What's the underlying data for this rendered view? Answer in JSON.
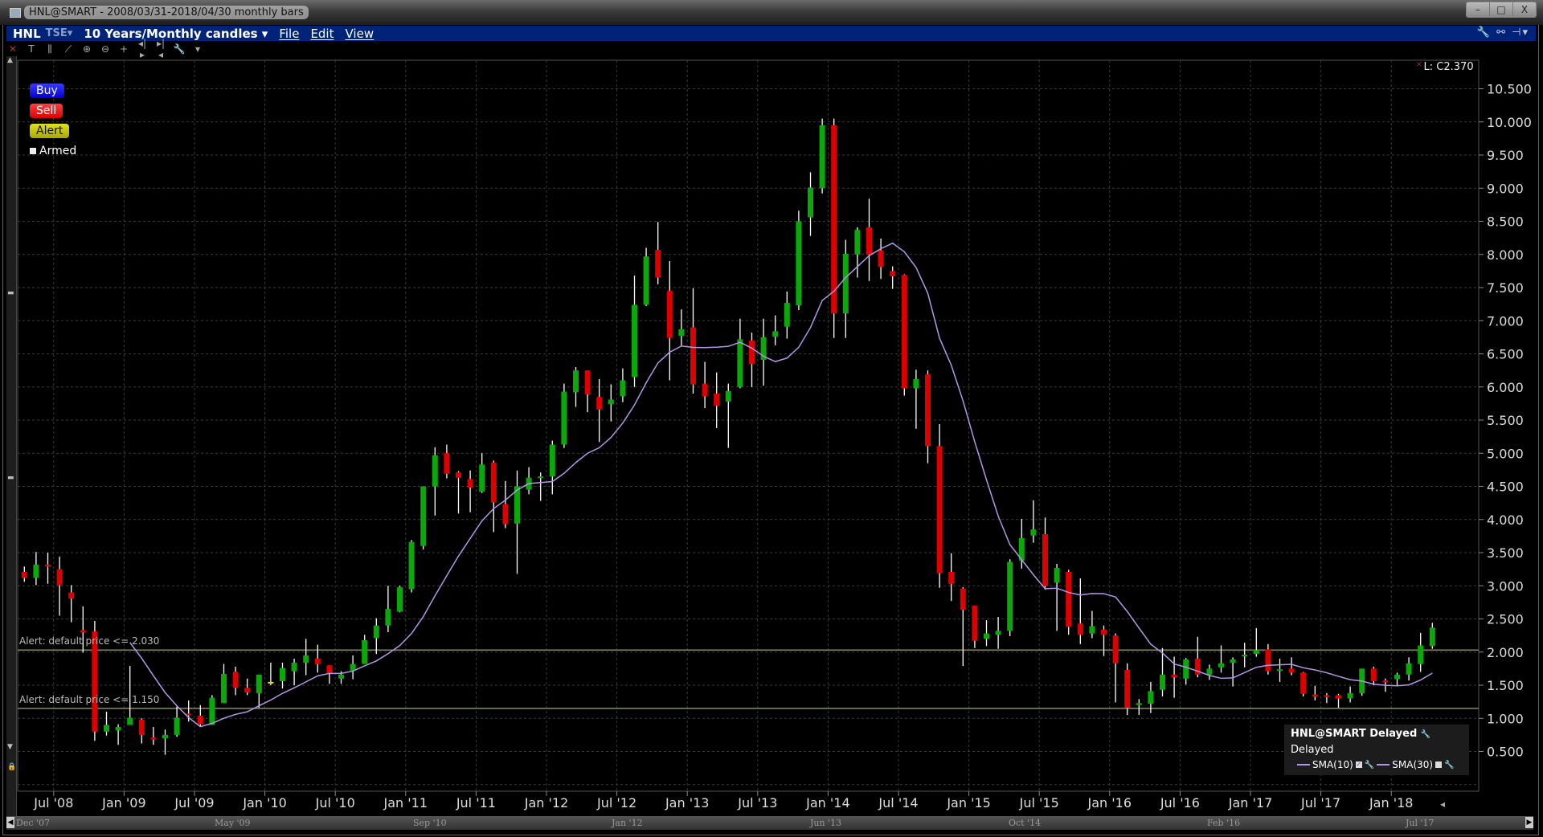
{
  "window": {
    "title": "HNL@SMART - 2008/03/31-2018/04/30 monthly bars",
    "controls": [
      "–",
      "□",
      "X"
    ]
  },
  "menubar": {
    "symbol": "HNL",
    "exchange": "TSE▾",
    "period": "10 Years/Monthly candles ▾",
    "menus": [
      "File",
      "Edit",
      "View"
    ],
    "right_icons": "🔧 ⚯ ⊣▾"
  },
  "toolbar": {
    "icons": [
      {
        "name": "close-icon",
        "glyph": "✕"
      },
      {
        "name": "text-icon",
        "glyph": "T"
      },
      {
        "name": "bars-icon",
        "glyph": "⫼"
      },
      {
        "name": "draw-line-icon",
        "glyph": "⟋"
      },
      {
        "name": "zoom-in-icon",
        "glyph": "⊕"
      },
      {
        "name": "zoom-out-icon",
        "glyph": "⊖"
      },
      {
        "name": "crosshair-icon",
        "glyph": "+"
      },
      {
        "name": "expand-icon",
        "glyph": "◂|▸"
      },
      {
        "name": "compress-icon",
        "glyph": "▸|◂"
      },
      {
        "name": "wrench-icon",
        "glyph": "🔧"
      },
      {
        "name": "dropdown-icon",
        "glyph": "▾"
      }
    ]
  },
  "order_panel": {
    "buy": "Buy",
    "sell": "Sell",
    "alert": "Alert",
    "armed": "Armed"
  },
  "alerts": [
    {
      "label": "Alert: default price <= 2.030",
      "price": 2.03
    },
    {
      "label": "Alert: default price <= 1.150",
      "price": 1.15
    }
  ],
  "last_value": "L: C2.370",
  "legend": {
    "title": "HNL@SMART Delayed",
    "status": "Delayed",
    "studies": [
      "SMA(10)",
      "SMA(30)"
    ]
  },
  "navigator": {
    "labels": [
      "Dec '07",
      "May '09",
      "Sep '10",
      "Jan '12",
      "Jun '13",
      "Oct '14",
      "Feb '16",
      "Jul '17"
    ]
  },
  "colors": {
    "up": "#0ba80b",
    "down": "#dd0000",
    "doji": "#e8e800",
    "sma": "#b496e6",
    "alert_line": "#8c8c52",
    "grid": "#3a3a3a"
  },
  "chart_data": {
    "type": "candlestick",
    "title": "HNL@SMART monthly bars",
    "start_month": "2008-04",
    "ylim": [
      0.0,
      10.75
    ],
    "yticks": [
      "10.500",
      "10.000",
      "9.500",
      "9.000",
      "8.500",
      "8.000",
      "7.500",
      "7.000",
      "6.500",
      "6.000",
      "5.500",
      "5.000",
      "4.500",
      "4.000",
      "3.500",
      "3.000",
      "2.500",
      "2.000",
      "1.500",
      "1.000",
      "0.500"
    ],
    "xticks": [
      "Jul '08",
      "Jan '09",
      "Jul '09",
      "Jan '10",
      "Jul '10",
      "Jan '11",
      "Jul '11",
      "Jan '12",
      "Jul '12",
      "Jan '13",
      "Jul '13",
      "Jan '14",
      "Jul '14",
      "Jan '15",
      "Jul '15",
      "Jan '16",
      "Jul '16",
      "Jan '17",
      "Jul '17",
      "Jan '18"
    ],
    "grid": true,
    "sma_period": 10,
    "ohlc": [
      [
        3.21,
        3.29,
        3.06,
        3.12
      ],
      [
        3.12,
        3.51,
        3.01,
        3.32
      ],
      [
        3.32,
        3.5,
        3.03,
        3.3
      ],
      [
        3.25,
        3.44,
        2.55,
        3.01
      ],
      [
        2.9,
        3.01,
        2.45,
        2.81
      ],
      [
        2.33,
        2.69,
        1.99,
        2.3
      ],
      [
        2.31,
        2.47,
        0.66,
        0.8
      ],
      [
        0.8,
        1.1,
        0.74,
        0.9
      ],
      [
        0.82,
        0.91,
        0.6,
        0.87
      ],
      [
        0.9,
        1.79,
        0.9,
        1.01
      ],
      [
        0.98,
        1.0,
        0.62,
        0.75
      ],
      [
        0.71,
        0.87,
        0.6,
        0.68
      ],
      [
        0.7,
        0.83,
        0.45,
        0.75
      ],
      [
        0.75,
        1.18,
        0.72,
        1.01
      ],
      [
        1.07,
        1.27,
        0.95,
        1.05
      ],
      [
        1.04,
        1.2,
        0.87,
        0.91
      ],
      [
        0.9,
        1.35,
        0.9,
        1.31
      ],
      [
        1.23,
        1.82,
        1.23,
        1.67
      ],
      [
        1.7,
        1.78,
        1.35,
        1.46
      ],
      [
        1.46,
        1.6,
        1.35,
        1.39
      ],
      [
        1.38,
        1.66,
        1.16,
        1.66
      ],
      [
        1.55,
        1.84,
        1.5,
        1.55
      ],
      [
        1.56,
        1.84,
        1.45,
        1.76
      ],
      [
        1.71,
        1.9,
        1.5,
        1.84
      ],
      [
        1.84,
        2.2,
        1.65,
        1.95
      ],
      [
        1.9,
        2.11,
        1.69,
        1.82
      ],
      [
        1.8,
        1.8,
        1.52,
        1.68
      ],
      [
        1.6,
        1.71,
        1.52,
        1.66
      ],
      [
        1.72,
        1.95,
        1.59,
        1.82
      ],
      [
        1.82,
        2.26,
        1.82,
        2.18
      ],
      [
        2.21,
        2.51,
        1.97,
        2.4
      ],
      [
        2.4,
        3.0,
        2.3,
        2.65
      ],
      [
        2.61,
        3.0,
        2.6,
        2.98
      ],
      [
        2.95,
        3.69,
        2.9,
        3.66
      ],
      [
        3.6,
        4.5,
        3.55,
        4.5
      ],
      [
        4.5,
        5.09,
        4.06,
        4.97
      ],
      [
        5.0,
        5.13,
        4.62,
        4.69
      ],
      [
        4.71,
        4.73,
        4.09,
        4.63
      ],
      [
        4.61,
        4.74,
        4.11,
        4.48
      ],
      [
        4.42,
        5.0,
        4.4,
        4.83
      ],
      [
        4.86,
        4.89,
        3.81,
        4.26
      ],
      [
        4.23,
        4.58,
        3.87,
        3.93
      ],
      [
        3.94,
        4.74,
        3.18,
        4.5
      ],
      [
        4.45,
        4.79,
        4.38,
        4.63
      ],
      [
        4.64,
        4.71,
        4.28,
        4.65
      ],
      [
        4.65,
        5.19,
        4.38,
        5.13
      ],
      [
        5.13,
        6.05,
        5.08,
        5.93
      ],
      [
        5.92,
        6.3,
        5.7,
        6.25
      ],
      [
        6.25,
        6.25,
        5.62,
        5.89
      ],
      [
        5.85,
        6.12,
        5.17,
        5.66
      ],
      [
        5.74,
        6.04,
        5.48,
        5.81
      ],
      [
        5.86,
        6.28,
        5.77,
        6.1
      ],
      [
        6.15,
        7.68,
        6.0,
        7.24
      ],
      [
        7.24,
        8.1,
        7.22,
        7.97
      ],
      [
        8.07,
        8.49,
        7.55,
        7.65
      ],
      [
        7.45,
        7.9,
        6.1,
        6.74
      ],
      [
        6.77,
        7.17,
        6.62,
        6.87
      ],
      [
        6.9,
        7.49,
        5.9,
        6.04
      ],
      [
        6.05,
        6.38,
        5.68,
        5.86
      ],
      [
        5.9,
        6.22,
        5.38,
        5.72
      ],
      [
        5.78,
        6.05,
        5.08,
        5.94
      ],
      [
        6.0,
        7.03,
        5.98,
        6.72
      ],
      [
        6.7,
        6.82,
        6.0,
        6.35
      ],
      [
        6.41,
        7.03,
        6.02,
        6.75
      ],
      [
        6.76,
        7.08,
        6.63,
        6.84
      ],
      [
        6.91,
        7.44,
        6.73,
        7.27
      ],
      [
        7.23,
        8.66,
        7.16,
        8.5
      ],
      [
        8.56,
        9.24,
        8.28,
        9.01
      ],
      [
        9.0,
        10.05,
        8.92,
        9.95
      ],
      [
        9.95,
        10.05,
        6.74,
        7.11
      ],
      [
        7.11,
        8.22,
        6.74,
        8.01
      ],
      [
        8.0,
        8.41,
        7.65,
        8.37
      ],
      [
        8.41,
        8.84,
        7.6,
        8.0
      ],
      [
        8.06,
        8.24,
        7.63,
        7.81
      ],
      [
        7.75,
        7.82,
        7.48,
        7.67
      ],
      [
        7.69,
        7.7,
        5.87,
        5.98
      ],
      [
        5.98,
        6.26,
        5.37,
        6.12
      ],
      [
        6.19,
        6.25,
        4.85,
        5.11
      ],
      [
        5.11,
        5.44,
        2.97,
        3.19
      ],
      [
        3.21,
        3.49,
        2.77,
        3.03
      ],
      [
        2.96,
        2.98,
        1.79,
        2.64
      ],
      [
        2.7,
        2.7,
        2.06,
        2.17
      ],
      [
        2.2,
        2.48,
        2.09,
        2.28
      ],
      [
        2.26,
        2.53,
        2.05,
        2.32
      ],
      [
        2.32,
        3.4,
        2.24,
        3.36
      ],
      [
        3.38,
        4.01,
        3.26,
        3.72
      ],
      [
        3.76,
        4.29,
        3.65,
        3.85
      ],
      [
        3.78,
        4.03,
        2.94,
        3.0
      ],
      [
        3.05,
        3.33,
        2.32,
        3.27
      ],
      [
        3.21,
        3.24,
        2.26,
        2.38
      ],
      [
        2.43,
        3.11,
        2.12,
        2.26
      ],
      [
        2.28,
        2.62,
        2.21,
        2.39
      ],
      [
        2.34,
        2.4,
        1.94,
        2.26
      ],
      [
        2.25,
        2.28,
        1.24,
        1.83
      ],
      [
        1.73,
        1.83,
        1.05,
        1.16
      ],
      [
        1.2,
        1.29,
        1.05,
        1.23
      ],
      [
        1.22,
        1.55,
        1.08,
        1.41
      ],
      [
        1.43,
        2.06,
        1.33,
        1.66
      ],
      [
        1.66,
        1.93,
        1.31,
        1.62
      ],
      [
        1.6,
        1.91,
        1.51,
        1.89
      ],
      [
        1.9,
        2.23,
        1.62,
        1.66
      ],
      [
        1.66,
        1.81,
        1.58,
        1.75
      ],
      [
        1.77,
        2.1,
        1.69,
        1.83
      ],
      [
        1.84,
        1.92,
        1.48,
        1.89
      ],
      [
        1.95,
        2.14,
        1.77,
        1.96
      ],
      [
        1.97,
        2.36,
        1.93,
        2.03
      ],
      [
        2.04,
        2.12,
        1.66,
        1.71
      ],
      [
        1.73,
        1.9,
        1.55,
        1.74
      ],
      [
        1.75,
        1.92,
        1.65,
        1.69
      ],
      [
        1.69,
        1.7,
        1.33,
        1.37
      ],
      [
        1.36,
        1.49,
        1.27,
        1.33
      ],
      [
        1.35,
        1.38,
        1.23,
        1.32
      ],
      [
        1.35,
        1.37,
        1.16,
        1.3
      ],
      [
        1.3,
        1.48,
        1.24,
        1.38
      ],
      [
        1.38,
        1.75,
        1.34,
        1.75
      ],
      [
        1.75,
        1.78,
        1.5,
        1.56
      ],
      [
        1.57,
        1.6,
        1.4,
        1.55
      ],
      [
        1.59,
        1.69,
        1.49,
        1.66
      ],
      [
        1.66,
        1.92,
        1.57,
        1.83
      ],
      [
        1.82,
        2.29,
        1.7,
        2.1
      ],
      [
        2.09,
        2.44,
        2.05,
        2.37
      ]
    ]
  }
}
